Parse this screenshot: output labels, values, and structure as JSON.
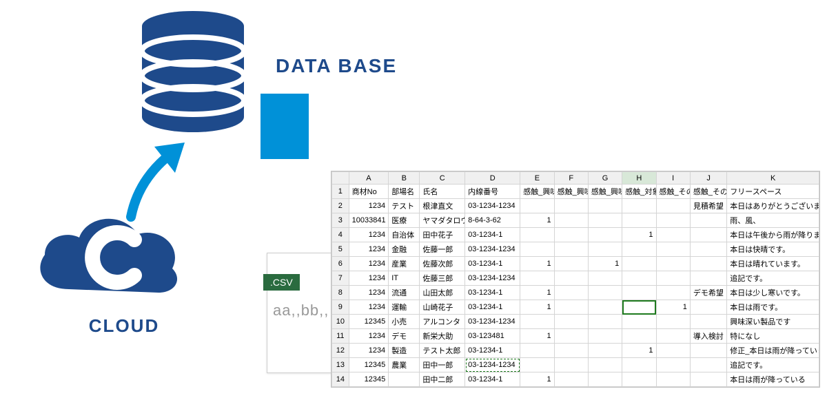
{
  "labels": {
    "cloud": "CLOUD",
    "database": "DATA BASE",
    "csv_badge": ".CSV",
    "csv_sample": "aa,,bb,,"
  },
  "colors": {
    "brand": "#1e4a8b",
    "accent": "#0091d8",
    "csv_badge": "#2a6b3f"
  },
  "sheet": {
    "columns": [
      "A",
      "B",
      "C",
      "D",
      "E",
      "F",
      "G",
      "H",
      "I",
      "J",
      "K"
    ],
    "headers": [
      "商材No",
      "部場名",
      "氏名",
      "内線番号",
      "感触_興味",
      "感触_興味",
      "感触_興味",
      "感触_対象",
      "感触_その他",
      "感触_その他",
      "フリースペース"
    ],
    "selected_col": "H",
    "selected_cell": [
      9,
      "H"
    ],
    "dashed_cell": [
      13,
      "D"
    ],
    "rows": [
      {
        "A": "1234",
        "B": "テスト",
        "C": "根津直文",
        "D": "03-1234-1234",
        "E": "",
        "F": "",
        "G": "",
        "H": "",
        "I": "",
        "J": "見積希望",
        "K": "本日はありがとうございまし"
      },
      {
        "A": "10033841",
        "B": "医療",
        "C": "ヤマダタロウ",
        "D": "8-64-3-62",
        "E": "1",
        "F": "",
        "G": "",
        "H": "",
        "I": "",
        "J": "",
        "K": "雨、風、"
      },
      {
        "A": "1234",
        "B": "自治体",
        "C": "田中花子",
        "D": "03-1234-1",
        "E": "",
        "F": "",
        "G": "",
        "H": "1",
        "I": "",
        "J": "",
        "K": "本日は午後から雨が降ります"
      },
      {
        "A": "1234",
        "B": "金融",
        "C": "佐藤一郎",
        "D": "03-1234-1234",
        "E": "",
        "F": "",
        "G": "",
        "H": "",
        "I": "",
        "J": "",
        "K": "本日は快晴です。"
      },
      {
        "A": "1234",
        "B": "産業",
        "C": "佐藤次郎",
        "D": "03-1234-1",
        "E": "1",
        "F": "",
        "G": "1",
        "H": "",
        "I": "",
        "J": "",
        "K": "本日は晴れています。"
      },
      {
        "A": "1234",
        "B": "IT",
        "C": "佐藤三郎",
        "D": "03-1234-1234",
        "E": "",
        "F": "",
        "G": "",
        "H": "",
        "I": "",
        "J": "",
        "K": "追記です。"
      },
      {
        "A": "1234",
        "B": "流通",
        "C": "山田太郎",
        "D": "03-1234-1",
        "E": "1",
        "F": "",
        "G": "",
        "H": "",
        "I": "",
        "J": "デモ希望",
        "K": "本日は少し寒いです。"
      },
      {
        "A": "1234",
        "B": "運輸",
        "C": "山崎花子",
        "D": "03-1234-1",
        "E": "1",
        "F": "",
        "G": "",
        "H": "",
        "I": "1",
        "J": "",
        "K": "本日は雨です。"
      },
      {
        "A": "12345",
        "B": "小売",
        "C": "アルコンタ",
        "D": "03-1234-1234",
        "E": "",
        "F": "",
        "G": "",
        "H": "",
        "I": "",
        "J": "",
        "K": "興味深い製品です"
      },
      {
        "A": "1234",
        "B": "デモ",
        "C": "新栄大助",
        "D": "03-123481",
        "E": "1",
        "F": "",
        "G": "",
        "H": "",
        "I": "",
        "J": "導入検討",
        "K": "特になし"
      },
      {
        "A": "1234",
        "B": "製造",
        "C": "テスト太郎",
        "D": "03-1234-1",
        "E": "",
        "F": "",
        "G": "",
        "H": "1",
        "I": "",
        "J": "",
        "K": "修正_本日は雨が降っていま"
      },
      {
        "A": "12345",
        "B": "農業",
        "C": "田中一郎",
        "D": "03-1234-1234",
        "E": "",
        "F": "",
        "G": "",
        "H": "",
        "I": "",
        "J": "",
        "K": "追記です。"
      },
      {
        "A": "12345",
        "B": "",
        "C": "田中二郎",
        "D": "03-1234-1",
        "E": "1",
        "F": "",
        "G": "",
        "H": "",
        "I": "",
        "J": "",
        "K": "本日は雨が降っている"
      }
    ]
  }
}
